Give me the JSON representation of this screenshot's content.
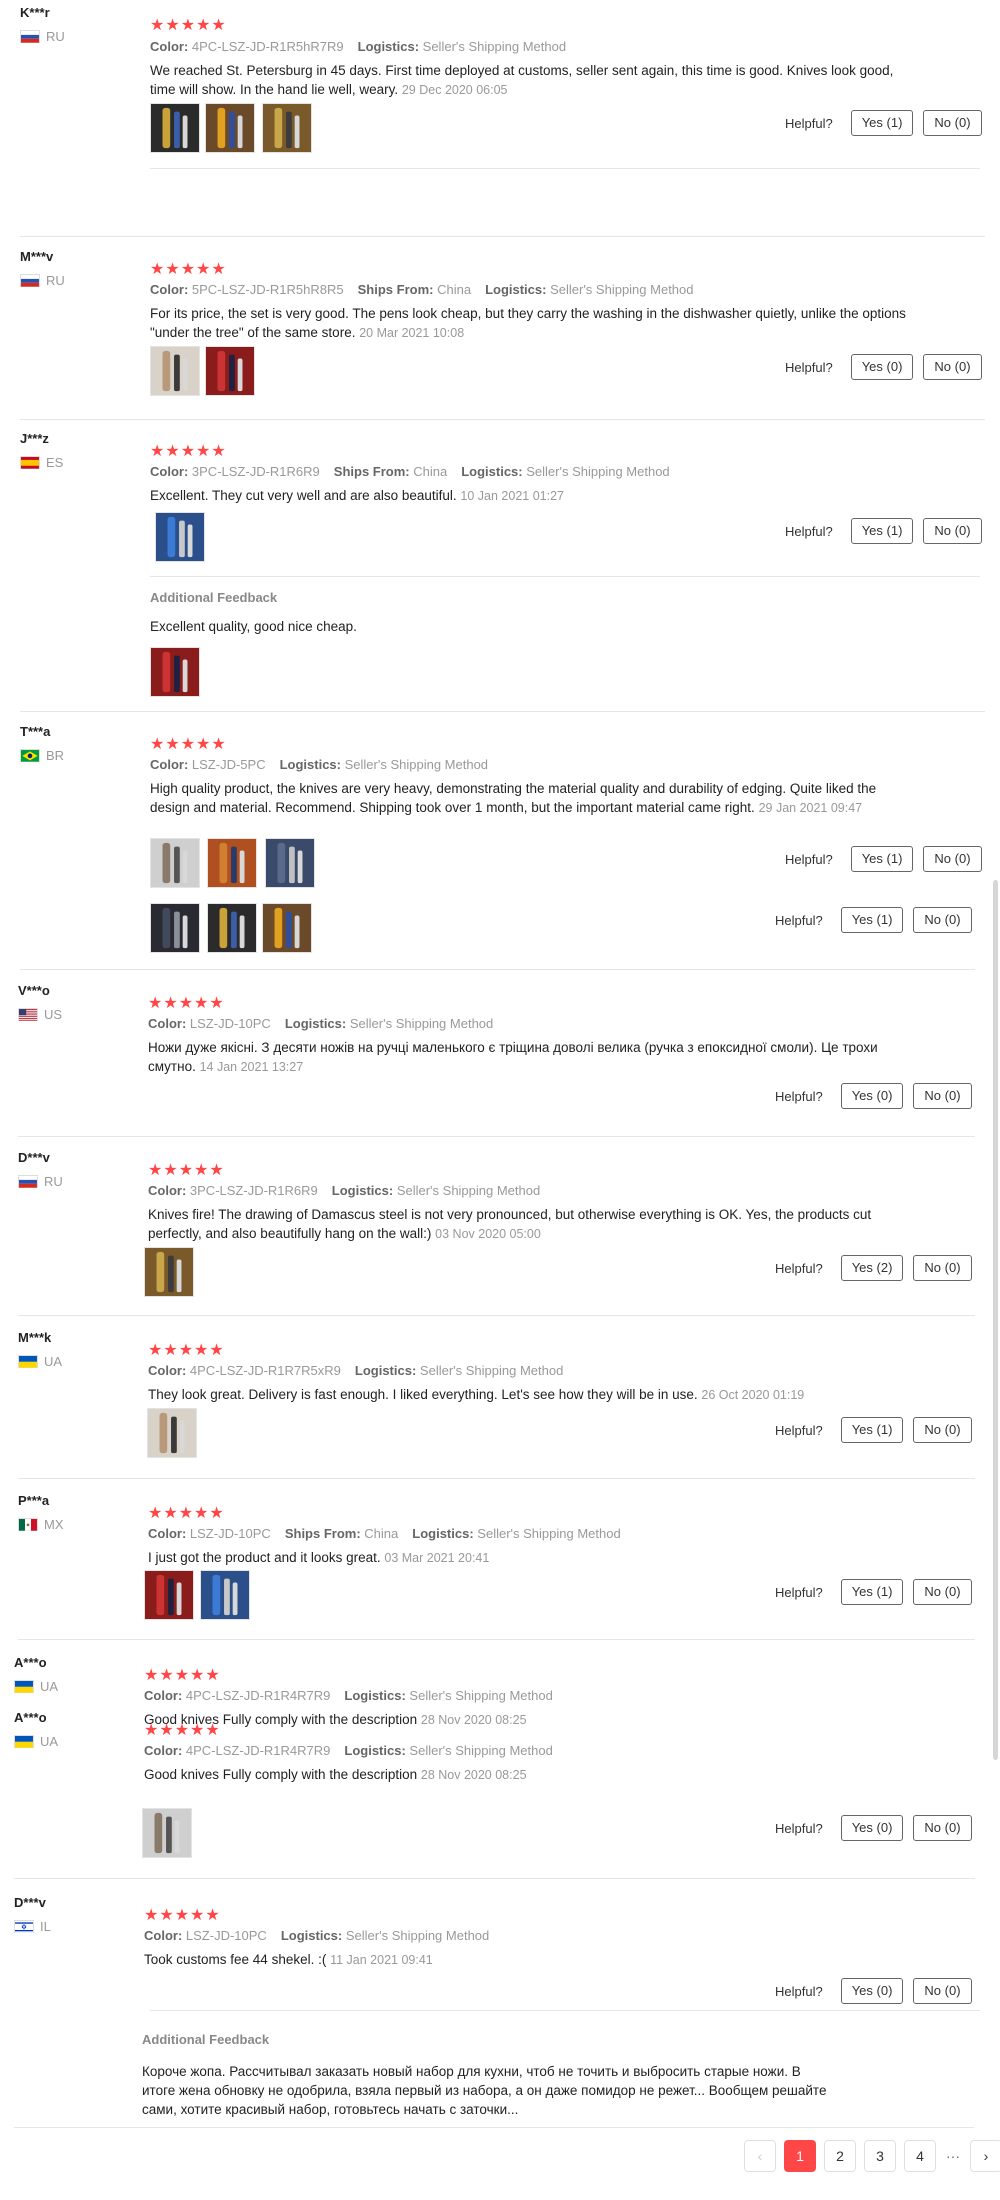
{
  "labels": {
    "color": "Color:",
    "logistics": "Logistics:",
    "ships_from": "Ships From:",
    "helpful": "Helpful?",
    "additional_feedback": "Additional Feedback",
    "stars": "★★★★★"
  },
  "reviews": [
    {
      "user": "K***r",
      "country": "RU",
      "flag": "ru",
      "color": "4PC-LSZ-JD-R1R5hR7R9",
      "ships_from": null,
      "logistics": "Seller's Shipping Method",
      "text": "We reached St. Petersburg in 45 days. First time deployed at customs, seller sent again, this time is good. Knives look good, time will show. In the hand lie well, weary.",
      "date": "29 Dec 2020 06:05",
      "yes": "Yes (1)",
      "no": "No (0)",
      "images": 3
    },
    {
      "user": "M***v",
      "country": "RU",
      "flag": "ru",
      "color": "5PC-LSZ-JD-R1R5hR8R5",
      "ships_from": "China",
      "logistics": "Seller's Shipping Method",
      "text": "For its price, the set is very good. The pens look cheap, but they carry the washing in the dishwasher quietly, unlike the options \"under the tree\" of the same store.",
      "date": "20 Mar 2021 10:08",
      "yes": "Yes (0)",
      "no": "No (0)",
      "images": 2
    },
    {
      "user": "J***z",
      "country": "ES",
      "flag": "es",
      "color": "3PC-LSZ-JD-R1R6R9",
      "ships_from": "China",
      "logistics": "Seller's Shipping Method",
      "text": "Excellent. They cut very well and are also beautiful.",
      "date": "10 Jan 2021 01:27",
      "yes": "Yes (1)",
      "no": "No (0)",
      "images": 1,
      "additional": "Excellent quality, good nice cheap."
    },
    {
      "user": "T***a",
      "country": "BR",
      "flag": "br",
      "color": "LSZ-JD-5PC",
      "ships_from": null,
      "logistics": "Seller's Shipping Method",
      "text": "High quality product, the knives are very heavy, demonstrating the material quality and durability of edging. Quite liked the design and material. Recommend. Shipping took over 1 month, but the important material came right.",
      "date": "29 Jan 2021 09:47",
      "yes": "Yes (1)",
      "no": "No (0)",
      "images": 3,
      "yes2": "Yes (1)",
      "no2": "No (0)"
    },
    {
      "user": "V***o",
      "country": "US",
      "flag": "us",
      "color": "LSZ-JD-10PC",
      "ships_from": null,
      "logistics": "Seller's Shipping Method",
      "text": "Ножи дуже якісні. З десяти ножів на ручці маленького є тріщина доволі велика (ручка з епоксидної смоли). Це трохи смутно.",
      "date": "14 Jan 2021 13:27",
      "yes": "Yes (0)",
      "no": "No (0)",
      "images": 0
    },
    {
      "user": "D***v",
      "country": "RU",
      "flag": "ru",
      "color": "3PC-LSZ-JD-R1R6R9",
      "ships_from": null,
      "logistics": "Seller's Shipping Method",
      "text": "Knives fire! The drawing of Damascus steel is not very pronounced, but otherwise everything is OK. Yes, the products cut perfectly, and also beautifully hang on the wall:)",
      "date": "03 Nov 2020 05:00",
      "yes": "Yes (2)",
      "no": "No (0)",
      "images": 1
    },
    {
      "user": "M***k",
      "country": "UA",
      "flag": "ua",
      "color": "4PC-LSZ-JD-R1R7R5xR9",
      "ships_from": null,
      "logistics": "Seller's Shipping Method",
      "text": "They look great. Delivery is fast enough. I liked everything. Let's see how they will be in use.",
      "date": "26 Oct 2020 01:19",
      "yes": "Yes (1)",
      "no": "No (0)",
      "images": 1
    },
    {
      "user": "P***a",
      "country": "MX",
      "flag": "mx",
      "color": "LSZ-JD-10PC",
      "ships_from": "China",
      "logistics": "Seller's Shipping Method",
      "text": "I just got the product and it looks great.",
      "date": "03 Mar 2021 20:41",
      "yes": "Yes (1)",
      "no": "No (0)",
      "images": 2
    },
    {
      "user": "A***o",
      "country": "UA",
      "flag": "ua",
      "color": "4PC-LSZ-JD-R1R4R7R9",
      "ships_from": null,
      "logistics": "Seller's Shipping Method",
      "text": "Good knives Fully comply with the description",
      "date": "28 Nov 2020 08:25",
      "yes": "Yes (0)",
      "no": "No (0)",
      "images": 1
    },
    {
      "user": "D***v",
      "country": "IL",
      "flag": "il",
      "color": "LSZ-JD-10PC",
      "ships_from": null,
      "logistics": "Seller's Shipping Method",
      "text": "Took customs fee 44 shekel. :(",
      "date": "11 Jan 2021 09:41",
      "yes": "Yes (0)",
      "no": "No (0)",
      "images": 0,
      "additional": "Короче жопа. Рассчитывал заказать новый набор для кухни, чтоб не точить и выбросить старые ножи. В итоге жена обновку не одобрила, взяла первый из набора, а он даже помидор не режет... Вообщем решайте сами, хотите красивый набор, готовьтесь начать с заточки..."
    }
  ],
  "pagination": {
    "prev": "‹",
    "pages": [
      "1",
      "2",
      "3",
      "4"
    ],
    "current": "1",
    "ellipsis": "···",
    "next": "›"
  }
}
